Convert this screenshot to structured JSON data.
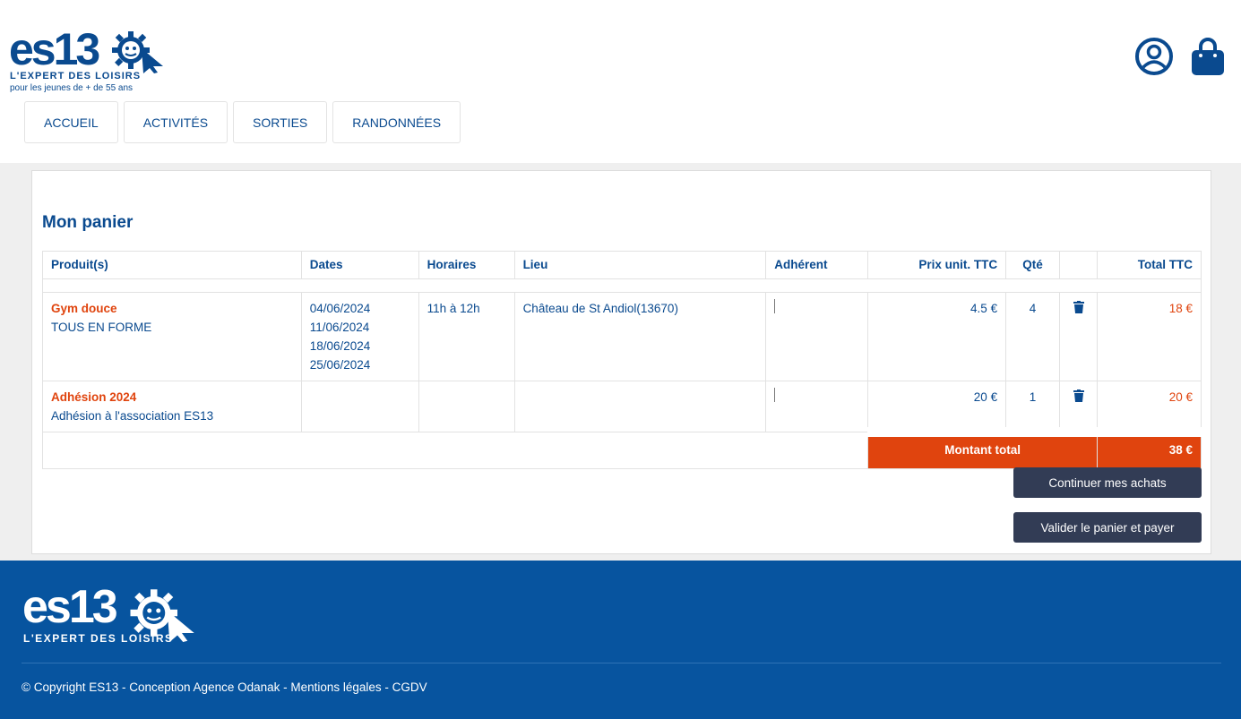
{
  "brand": {
    "logo_text": "es13",
    "tagline": "L'EXPERT DES LOISIRS",
    "subtitle": "pour les jeunes de + de 55 ans",
    "colors": {
      "primary": "#0a4a8f",
      "accent": "#e0440e",
      "button": "#323c55",
      "footer": "#07549f"
    }
  },
  "header_icons": {
    "account": "user-circle-icon",
    "cart": "shopping-bag-icon"
  },
  "nav": {
    "items": [
      {
        "label": "ACCUEIL"
      },
      {
        "label": "ACTIVITÉS"
      },
      {
        "label": "SORTIES"
      },
      {
        "label": "RANDONNÉES"
      }
    ]
  },
  "cart": {
    "title": "Mon panier",
    "columns": {
      "product": "Produit(s)",
      "dates": "Dates",
      "hours": "Horaires",
      "place": "Lieu",
      "member": "Adhérent",
      "unit_price": "Prix unit. TTC",
      "qty": "Qté",
      "action": "",
      "total": "Total TTC"
    },
    "rows": [
      {
        "name": "Gym douce",
        "subtitle": "TOUS EN FORME",
        "dates": [
          "04/06/2024",
          "11/06/2024",
          "18/06/2024",
          "25/06/2024"
        ],
        "hours": "11h à 12h",
        "place": "Château de St Andiol(13670)",
        "unit_price": "4.5 €",
        "qty": "4",
        "total": "18 €"
      },
      {
        "name": "Adhésion 2024",
        "subtitle": "Adhésion à l'association ES13",
        "dates": [],
        "hours": "",
        "place": "",
        "unit_price": "20 €",
        "qty": "1",
        "total": "20 €"
      }
    ],
    "total_label": "Montant total",
    "total_value": "38 €",
    "continue_label": "Continuer mes achats",
    "pay_label": "Valider le panier et payer"
  },
  "footer": {
    "logo_text": "es13",
    "tagline": "L'EXPERT DES LOISIRS",
    "copyright": "© Copyright ES13 - Conception Agence Odanak - Mentions légales - CGDV"
  }
}
